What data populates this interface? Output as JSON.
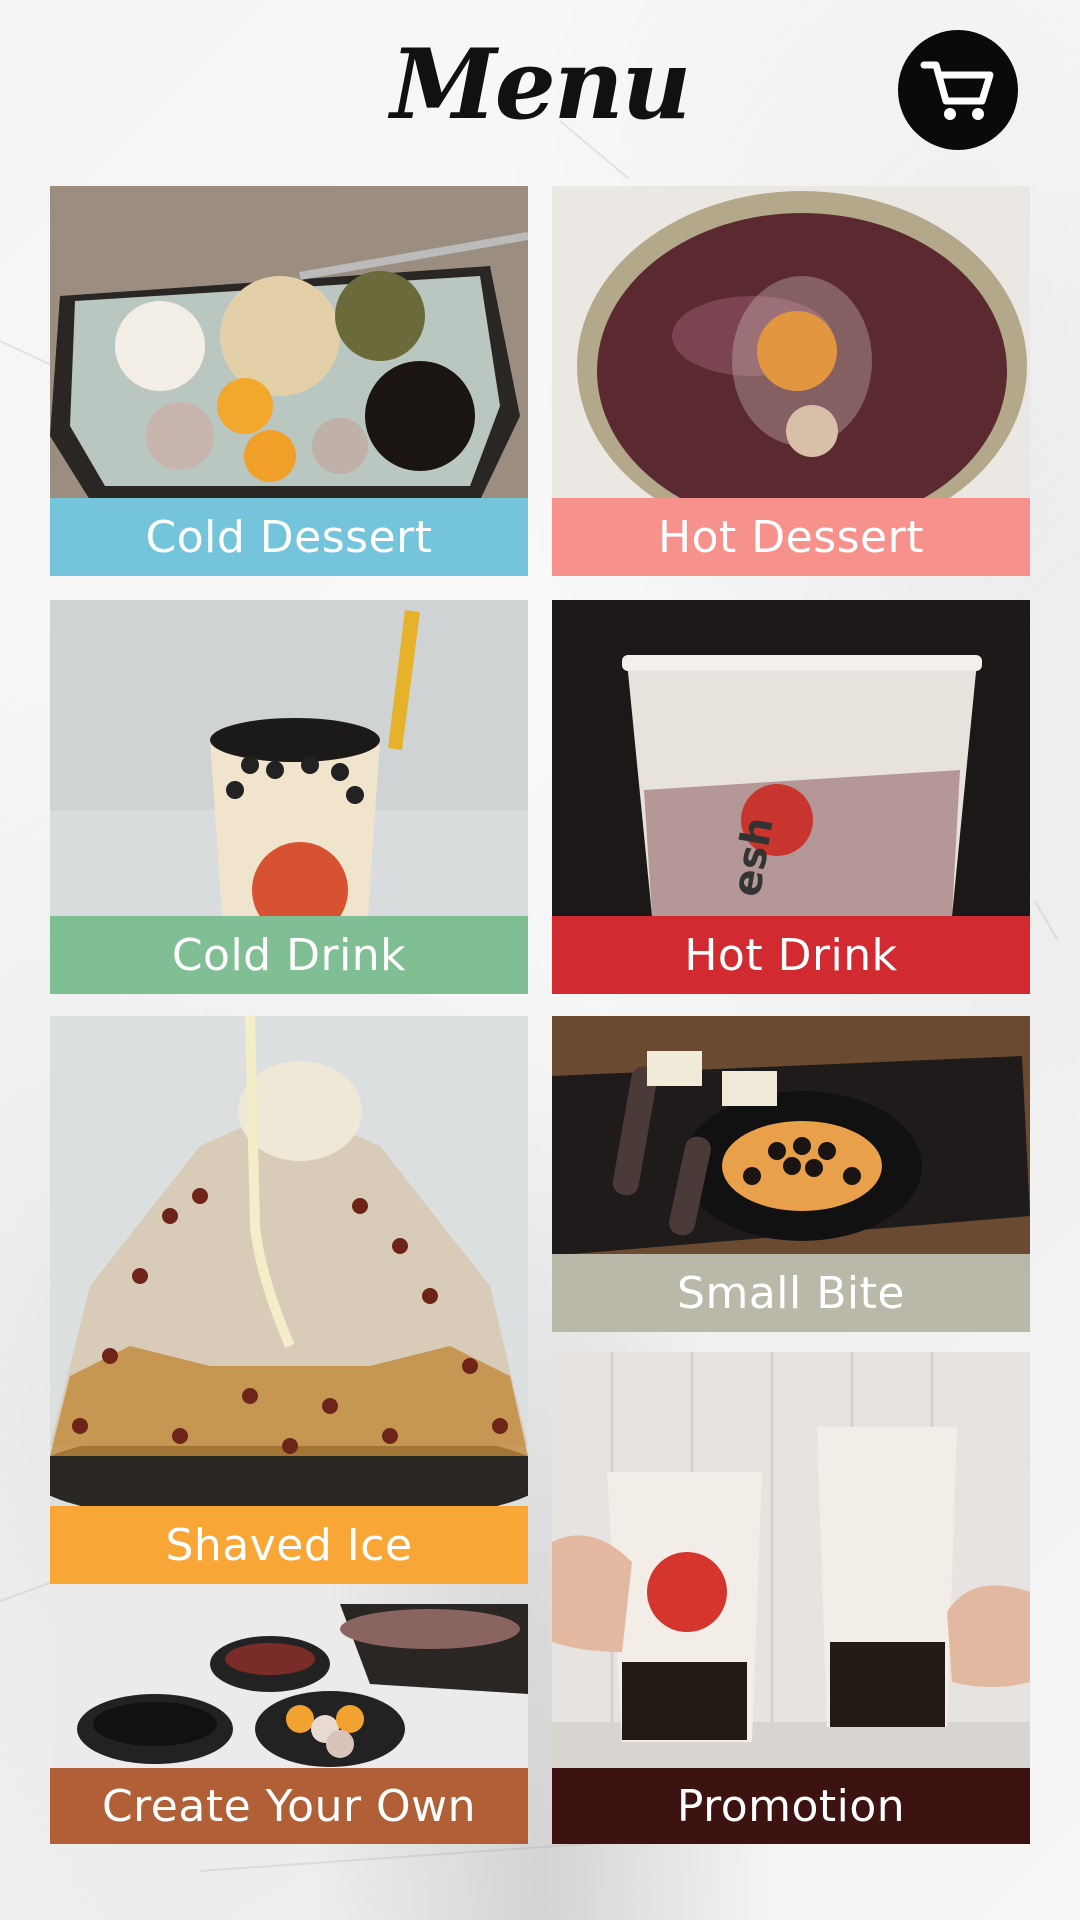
{
  "header": {
    "title": "Menu"
  },
  "cart": {
    "icon": "cart-icon"
  },
  "categories": [
    {
      "label": "Cold Dessert",
      "color": "#74c5db"
    },
    {
      "label": "Hot Dessert",
      "color": "#f7918b"
    },
    {
      "label": "Cold Drink",
      "color": "#7fbf93"
    },
    {
      "label": "Hot Drink",
      "color": "#d12a30"
    },
    {
      "label": "Shaved Ice",
      "color": "#f8a736"
    },
    {
      "label": "Small Bite",
      "color": "#bab9a9"
    },
    {
      "label": "Create Your Own",
      "color": "#b05f37"
    },
    {
      "label": "Promotion",
      "color": "#3d1311"
    }
  ]
}
